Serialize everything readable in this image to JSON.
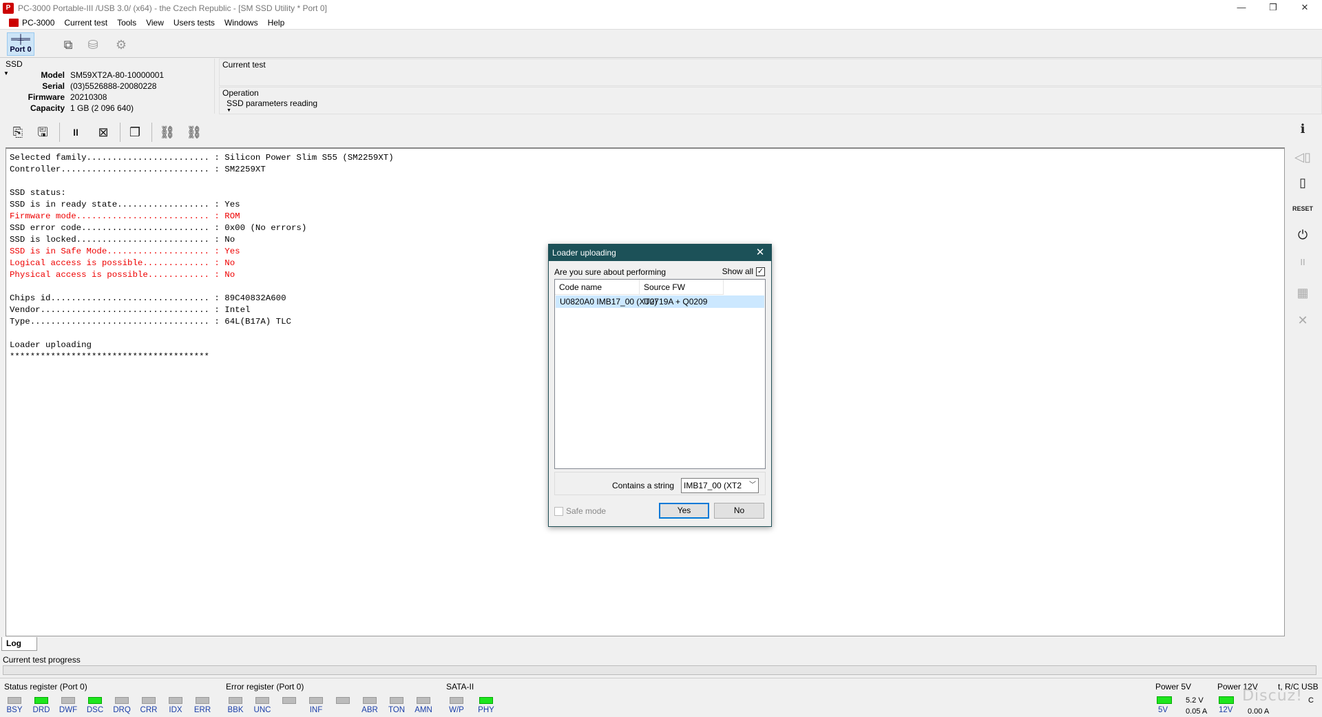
{
  "window": {
    "title": "PC-3000 Portable-III /USB 3.0/ (x64) - the Czech Republic - [SM SSD Utility * Port 0]",
    "app_icon": "pc3000-app-icon",
    "minimize": "—",
    "restore": "❒",
    "close": "✕"
  },
  "menu": {
    "items": [
      "PC-3000",
      "Current test",
      "Tools",
      "View",
      "Users tests",
      "Windows",
      "Help"
    ],
    "mdi_minimize": "_",
    "mdi_restore": "❐",
    "mdi_close": "✕"
  },
  "toolbar1": {
    "port_label": "Port 0",
    "port_icon": "═╪═"
  },
  "ssd": {
    "title": "SSD",
    "model_label": "Model",
    "model": "SM59XT2A-80-10000001",
    "serial_label": "Serial",
    "serial": "(03)5526888-20080228",
    "firmware_label": "Firmware",
    "firmware": "20210308",
    "capacity_label": "Capacity",
    "capacity": "1 GB (2 096 640)"
  },
  "current_test": {
    "label": "Current test",
    "value": ""
  },
  "operation": {
    "label": "Operation",
    "value": "SSD parameters reading"
  },
  "log": {
    "lines": [
      {
        "text": "Selected family........................ : Silicon Power Slim S55 (SM2259XT)",
        "red": false
      },
      {
        "text": "Controller............................. : SM2259XT",
        "red": false
      },
      {
        "text": "",
        "red": false
      },
      {
        "text": "SSD status:",
        "red": false
      },
      {
        "text": "SSD is in ready state.................. : Yes",
        "red": false
      },
      {
        "text": "Firmware mode.......................... : ROM",
        "red": true
      },
      {
        "text": "SSD error code......................... : 0x00 (No errors)",
        "red": false
      },
      {
        "text": "SSD is locked.......................... : No",
        "red": false
      },
      {
        "text": "SSD is in Safe Mode.................... : Yes",
        "red": true
      },
      {
        "text": "Logical access is possible............. : No",
        "red": true
      },
      {
        "text": "Physical access is possible............ : No",
        "red": true
      },
      {
        "text": "",
        "red": false
      },
      {
        "text": "Chips id............................... : 89C40832A600",
        "red": false
      },
      {
        "text": "Vendor................................. : Intel",
        "red": false
      },
      {
        "text": "Type................................... : 64L(B17A) TLC",
        "red": false
      },
      {
        "text": "",
        "red": false
      },
      {
        "text": "Loader uploading",
        "red": false
      },
      {
        "text": "***************************************",
        "red": false
      }
    ],
    "tab_label": "Log"
  },
  "progress": {
    "label": "Current test progress",
    "value": 0
  },
  "status_register": {
    "title": "Status register (Port 0)",
    "leds": [
      {
        "label": "BSY",
        "on": false
      },
      {
        "label": "DRD",
        "on": true
      },
      {
        "label": "DWF",
        "on": false
      },
      {
        "label": "DSC",
        "on": true
      },
      {
        "label": "DRQ",
        "on": false
      },
      {
        "label": "CRR",
        "on": false
      },
      {
        "label": "IDX",
        "on": false
      },
      {
        "label": "ERR",
        "on": false
      }
    ]
  },
  "error_register": {
    "title": "Error register (Port 0)",
    "leds": [
      {
        "label": "BBK",
        "on": false
      },
      {
        "label": "UNC",
        "on": false
      },
      {
        "label": "",
        "on": false
      },
      {
        "label": "INF",
        "on": false
      },
      {
        "label": "",
        "on": false
      },
      {
        "label": "ABR",
        "on": false
      },
      {
        "label": "TON",
        "on": false
      },
      {
        "label": "AMN",
        "on": false
      }
    ]
  },
  "sata": {
    "title": "SATA-II",
    "leds": [
      {
        "label": "W/P",
        "on": false
      },
      {
        "label": "PHY",
        "on": true
      }
    ]
  },
  "power": {
    "p5_title": "Power 5V",
    "p5_label": "5V",
    "p5_voltage": "5.2 V",
    "p5_current": "0.05 A",
    "p12_title": "Power 12V",
    "p12_label": "12V",
    "p12_current": "0.00 A",
    "rc_title": "t, R/C USB",
    "rc_value": "C"
  },
  "dialog": {
    "title": "Loader uploading",
    "question": "Are you sure about performing",
    "show_all_label": "Show all",
    "show_all_checked": true,
    "columns": [
      "Code name",
      "Source FW"
    ],
    "rows": [
      [
        "U0820A0 IMB17_00 (XT2)",
        "U0719A + Q0209"
      ]
    ],
    "filter_label": "Contains a string",
    "filter_value": "IMB17_00 (XT2",
    "safe_mode_label": "Safe mode",
    "yes_label": "Yes",
    "no_label": "No"
  },
  "watermark": "Discuz!",
  "colors": {
    "dialog_title_bg": "#1c5158",
    "led_on": "#1ee51e",
    "log_red": "#e00000",
    "selection": "#cce8ff"
  }
}
